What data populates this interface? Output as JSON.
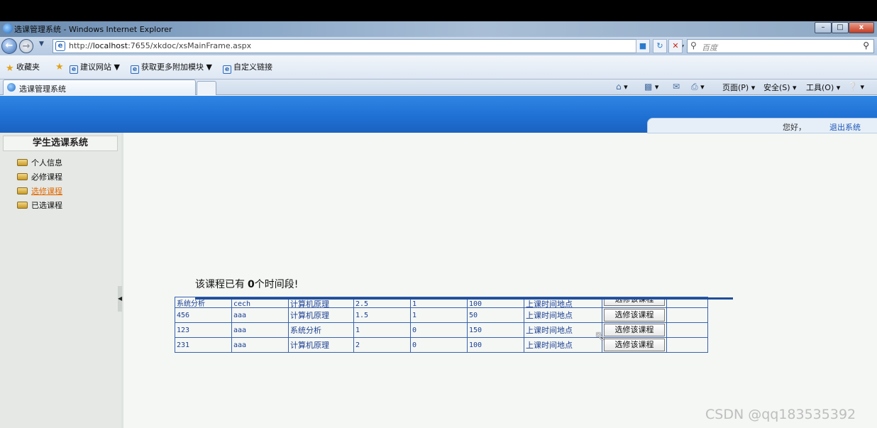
{
  "window": {
    "title": "选课管理系统 - Windows Internet Explorer",
    "min": "–",
    "max": "□",
    "close": "x"
  },
  "addressbar": {
    "url_prefix": "http://",
    "url_host": "localhost",
    "url_path": ":7655/xkdoc/xsMainFrame.aspx",
    "search_placeholder": "百度"
  },
  "favorites": {
    "label": "收藏夹",
    "items": [
      "建议网站 ▼",
      "获取更多附加模块 ▼",
      "自定义链接"
    ]
  },
  "tab": {
    "label": "选课管理系统"
  },
  "commandbar": {
    "page": "页面(P) ▾",
    "safety": "安全(S) ▾",
    "tools": "工具(O) ▾"
  },
  "header": {
    "greeting": "您好，",
    "logout": "退出系统"
  },
  "sidebar": {
    "title": "学生选课系统",
    "items": [
      {
        "label": "个人信息",
        "active": false
      },
      {
        "label": "必修课程",
        "active": false
      },
      {
        "label": "选修课程",
        "active": true
      },
      {
        "label": "已选课程",
        "active": false
      }
    ]
  },
  "message": {
    "prefix": "该课程已有",
    "count": "0",
    "suffix": "个时间段!"
  },
  "table": {
    "rows": [
      {
        "id": "系统分析",
        "teacher": "cech",
        "course": "计算机原理",
        "credit": "2.5",
        "type": "1",
        "capacity": "100",
        "link": "上课时间地点",
        "button": "选修该课程"
      },
      {
        "id": "456",
        "teacher": "aaa",
        "course": "计算机原理",
        "credit": "1.5",
        "type": "1",
        "capacity": "50",
        "link": "上课时间地点",
        "button": "选修该课程"
      },
      {
        "id": "123",
        "teacher": "aaa",
        "course": "系统分析",
        "credit": "1",
        "type": "0",
        "capacity": "150",
        "link": "上课时间地点",
        "button": "选修该课程"
      },
      {
        "id": "231",
        "teacher": "aaa",
        "course": "计算机原理",
        "credit": "2",
        "type": "0",
        "capacity": "100",
        "link": "上课时间地点",
        "button": "选修该课程"
      }
    ]
  },
  "watermark": "CSDN @qq183535392"
}
